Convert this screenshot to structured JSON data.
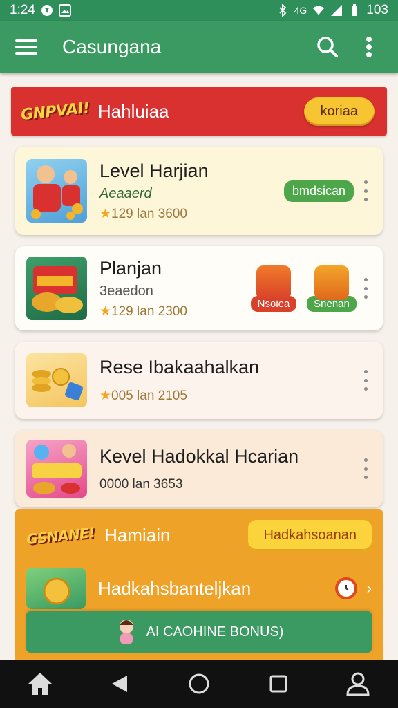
{
  "status_bar": {
    "time": "1:24",
    "battery": "103",
    "network": "4G"
  },
  "app_bar": {
    "title": "Casungana",
    "icons": [
      "menu-icon",
      "search-icon",
      "more-vert-icon"
    ]
  },
  "banner": {
    "logo_text": "GNPVAI!",
    "text": "Hahluiaa",
    "button_label": "koriaa",
    "color": "#d9312f"
  },
  "games": [
    {
      "title": "Level Harjian",
      "subtitle": "Aeaaerd",
      "rating": "129",
      "meta": "lan 3600",
      "tag": "bmdsican"
    },
    {
      "title": "Planjan",
      "subtitle": "3eaedon",
      "rating": "129",
      "meta": "lan 2300",
      "mini_cards": [
        {
          "label": "Nsoiea"
        },
        {
          "label": "Snenan"
        }
      ]
    },
    {
      "title": "Rese Ibakaahalkan",
      "rating": "005",
      "meta": "lan 2105"
    },
    {
      "title": "Kevel Hadokkal Hcarian",
      "meta": "0000 lan 3653"
    }
  ],
  "promo": {
    "logo_text": "GSNANE!",
    "title": "Hamiain",
    "button_label": "Hadkahsoanan",
    "row_text": "Hadkahsbanteljkan",
    "bonus_label": "AI CAOHINE BONUS)",
    "color": "#efa228"
  },
  "nav": [
    "home-icon",
    "back-icon",
    "circle-home-icon",
    "recents-icon",
    "profile-icon"
  ],
  "colors": {
    "primary": "#3a9a62",
    "accent": "#f7c532",
    "red": "#d9312f"
  }
}
